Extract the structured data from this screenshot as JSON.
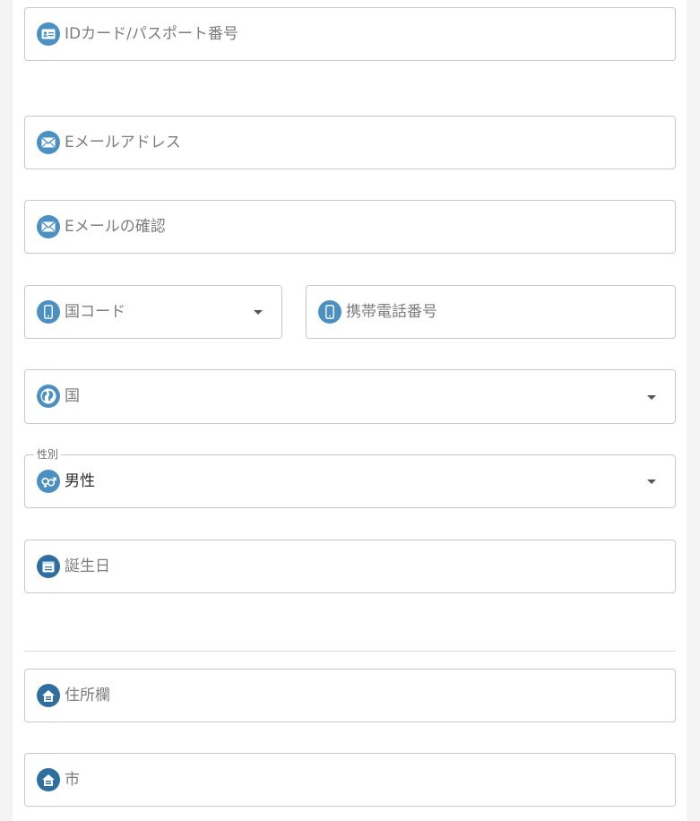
{
  "form": {
    "id_number": {
      "placeholder": "IDカード/パスポート番号",
      "icon": "id-card-icon"
    },
    "email": {
      "placeholder": "Eメールアドレス",
      "icon": "envelope-icon"
    },
    "email_confirm": {
      "placeholder": "Eメールの確認",
      "icon": "envelope-icon"
    },
    "country_code": {
      "placeholder": "国コード",
      "icon": "smartphone-icon"
    },
    "mobile": {
      "placeholder": "携帯電話番号",
      "icon": "smartphone-icon"
    },
    "country": {
      "placeholder": "国",
      "icon": "globe-icon"
    },
    "gender": {
      "legend": "性別",
      "value": "男性",
      "icon": "gender-icon"
    },
    "birthday": {
      "placeholder": "誕生日",
      "icon": "calendar-icon"
    },
    "address": {
      "placeholder": "住所欄",
      "icon": "home-icon"
    },
    "city": {
      "placeholder": "市",
      "icon": "home-icon"
    }
  },
  "colors": {
    "accent": "#4a90c2",
    "border": "#c9c9c9",
    "placeholder": "#7d7d7d"
  }
}
